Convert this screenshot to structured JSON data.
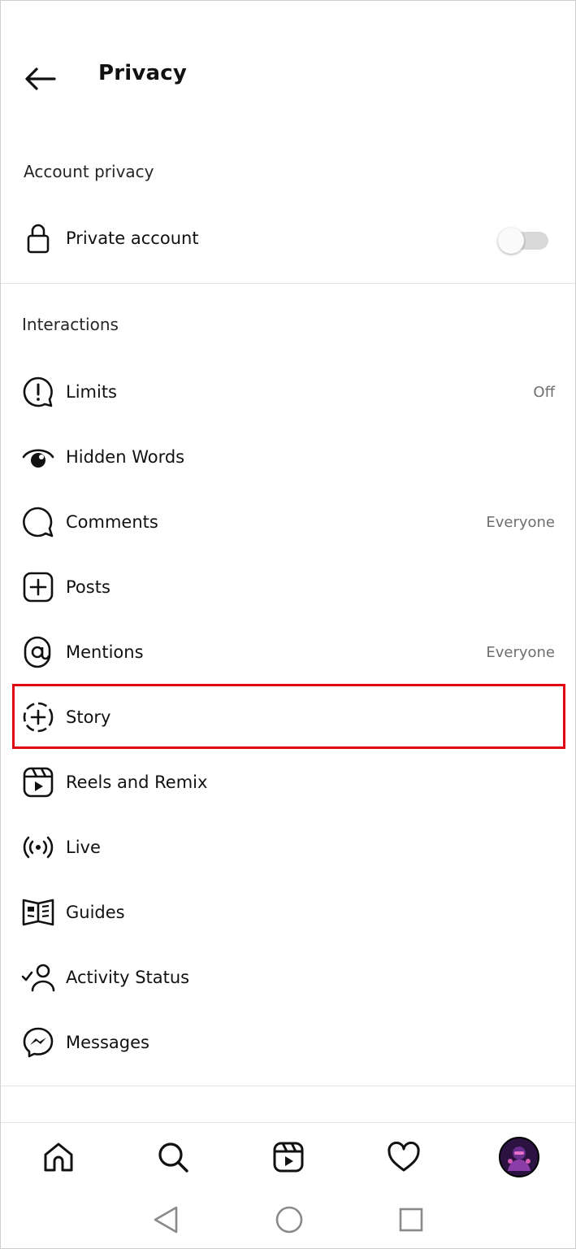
{
  "header": {
    "title": "Privacy",
    "back_icon": "arrow-left-icon"
  },
  "account_privacy": {
    "heading": "Account privacy",
    "private_account": {
      "label": "Private account",
      "icon": "lock-icon",
      "enabled": false
    }
  },
  "interactions": {
    "heading": "Interactions",
    "items": [
      {
        "label": "Limits",
        "value": "Off",
        "icon": "limits-icon"
      },
      {
        "label": "Hidden Words",
        "value": "",
        "icon": "hidden-words-icon"
      },
      {
        "label": "Comments",
        "value": "Everyone",
        "icon": "comment-icon"
      },
      {
        "label": "Posts",
        "value": "",
        "icon": "plus-square-icon"
      },
      {
        "label": "Mentions",
        "value": "Everyone",
        "icon": "at-sign-icon"
      },
      {
        "label": "Story",
        "value": "",
        "icon": "story-add-icon"
      },
      {
        "label": "Reels and Remix",
        "value": "",
        "icon": "reels-icon"
      },
      {
        "label": "Live",
        "value": "",
        "icon": "live-icon"
      },
      {
        "label": "Guides",
        "value": "",
        "icon": "guides-icon"
      },
      {
        "label": "Activity Status",
        "value": "",
        "icon": "activity-status-icon"
      },
      {
        "label": "Messages",
        "value": "",
        "icon": "messenger-icon"
      }
    ]
  },
  "highlight": {
    "color": "#e3000f",
    "target": "Story"
  },
  "bottom_nav": {
    "items": [
      "home-icon",
      "search-icon",
      "reels-icon",
      "heart-icon",
      "profile-avatar"
    ]
  },
  "system_nav": {
    "items": [
      "back-triangle-icon",
      "home-circle-icon",
      "recents-square-icon"
    ]
  },
  "colors": {
    "text": "#111111",
    "secondary_text": "#6e6e6e",
    "divider": "#e5e5e5",
    "toggle_track": "#d9d9d9"
  }
}
